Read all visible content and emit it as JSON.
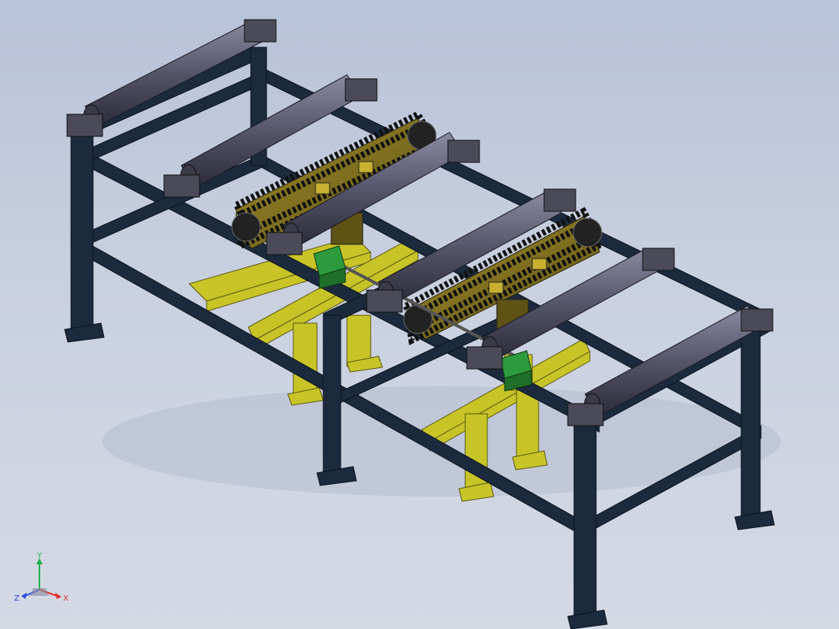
{
  "viewport": {
    "background_top": "#b8c2d8",
    "background_bottom": "#d4d9e4"
  },
  "model": {
    "frame_color": "#1b2a3d",
    "roller_color": "#4a4a5e",
    "chain_plate_color": "#7a6a1c",
    "support_color": "#c8c428",
    "gearbox_color": "#2e9a3e"
  },
  "triad": {
    "y_label": "Y",
    "x_label": "X",
    "z_label": "Z",
    "y_color": "#21b24a",
    "x_color": "#e0322a",
    "z_color": "#2a4ae0"
  }
}
